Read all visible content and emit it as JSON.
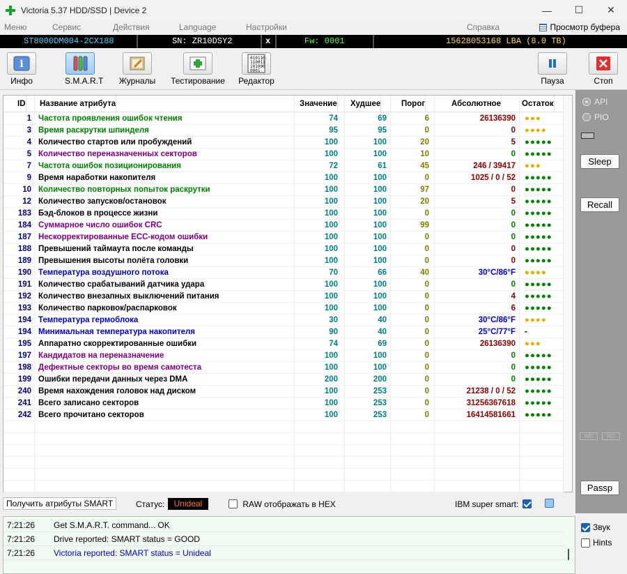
{
  "window": {
    "title": "Victoria 5.37 HDD/SSD | Device 2",
    "min": "—",
    "max": "☐",
    "close": "✕"
  },
  "menu": [
    "Меню",
    "Сервис",
    "Действия",
    "Language",
    "Настройки",
    "Справка"
  ],
  "buffer_label": "Просмотр буфера",
  "info": {
    "model": "ST8000DM004-2CX188",
    "sn": "SN: ZR10DSY2",
    "x": "x",
    "fw": "Fw: 0001",
    "lba": "15628053168 LBA (8.0 TB)"
  },
  "toolbar": {
    "info": "Инфо",
    "smart": "S.M.A.R.T",
    "logs": "Журналы",
    "test": "Тестирование",
    "editor": "Редактор",
    "pause": "Пауза",
    "stop": "Стоп"
  },
  "headers": {
    "id": "ID",
    "name": "Название атрибута",
    "value": "Значение",
    "worst": "Худшее",
    "thresh": "Порог",
    "raw": "Абсолютное",
    "health": "Остаток"
  },
  "colors": {
    "green": "#008000",
    "blue": "#0000cc",
    "purple": "#800080",
    "black": "#000000",
    "teal": "#008080",
    "olive": "#808000",
    "raw": "#8b0000",
    "dot_green": "#008000",
    "dot_yellow": "#e0b000"
  },
  "rows": [
    {
      "id": "1",
      "name": "Частота проявления ошибок чтения",
      "c": "green",
      "val": "74",
      "worst": "69",
      "thr": "6",
      "raw": "26136390",
      "rawc": "raw",
      "hl": "●●●",
      "hc": "dot_yellow"
    },
    {
      "id": "3",
      "name": "Время раскрутки шпинделя",
      "c": "green",
      "val": "95",
      "worst": "95",
      "thr": "0",
      "raw": "0",
      "rawc": "raw",
      "hl": "●●●●",
      "hc": "dot_yellow"
    },
    {
      "id": "4",
      "name": "Количество стартов или пробуждений",
      "c": "black",
      "val": "100",
      "worst": "100",
      "thr": "20",
      "raw": "5",
      "rawc": "raw",
      "hl": "●●●●●",
      "hc": "dot_green"
    },
    {
      "id": "5",
      "name": "Количество переназначенных секторов",
      "c": "purple",
      "val": "100",
      "worst": "100",
      "thr": "10",
      "raw": "0",
      "rawc": "green",
      "hl": "●●●●●",
      "hc": "dot_green"
    },
    {
      "id": "7",
      "name": "Частота ошибок позиционирования",
      "c": "green",
      "val": "72",
      "worst": "61",
      "thr": "45",
      "raw": "246 / 39417",
      "rawc": "raw",
      "hl": "●●●",
      "hc": "dot_yellow"
    },
    {
      "id": "9",
      "name": "Время наработки накопителя",
      "c": "black",
      "val": "100",
      "worst": "100",
      "thr": "0",
      "raw": "1025 / 0 / 52",
      "rawc": "raw",
      "hl": "●●●●●",
      "hc": "dot_green"
    },
    {
      "id": "10",
      "name": "Количество повторных попыток раскрутки",
      "c": "green",
      "val": "100",
      "worst": "100",
      "thr": "97",
      "raw": "0",
      "rawc": "raw",
      "hl": "●●●●●",
      "hc": "dot_green"
    },
    {
      "id": "12",
      "name": "Количество запусков/остановок",
      "c": "black",
      "val": "100",
      "worst": "100",
      "thr": "20",
      "raw": "5",
      "rawc": "raw",
      "hl": "●●●●●",
      "hc": "dot_green"
    },
    {
      "id": "183",
      "name": "Бэд-блоков в процессе жизни",
      "c": "black",
      "val": "100",
      "worst": "100",
      "thr": "0",
      "raw": "0",
      "rawc": "green",
      "hl": "●●●●●",
      "hc": "dot_green"
    },
    {
      "id": "184",
      "name": "Суммарное число ошибок CRC",
      "c": "purple",
      "val": "100",
      "worst": "100",
      "thr": "99",
      "raw": "0",
      "rawc": "green",
      "hl": "●●●●●",
      "hc": "dot_green"
    },
    {
      "id": "187",
      "name": "Нескорректированные ECC-кодом ошибки",
      "c": "purple",
      "val": "100",
      "worst": "100",
      "thr": "0",
      "raw": "0",
      "rawc": "green",
      "hl": "●●●●●",
      "hc": "dot_green"
    },
    {
      "id": "188",
      "name": "Превышений таймаута после команды",
      "c": "black",
      "val": "100",
      "worst": "100",
      "thr": "0",
      "raw": "0",
      "rawc": "raw",
      "hl": "●●●●●",
      "hc": "dot_green"
    },
    {
      "id": "189",
      "name": "Превышения высоты полёта головки",
      "c": "black",
      "val": "100",
      "worst": "100",
      "thr": "0",
      "raw": "0",
      "rawc": "raw",
      "hl": "●●●●●",
      "hc": "dot_green"
    },
    {
      "id": "190",
      "name": "Температура воздушного потока",
      "c": "blue",
      "val": "70",
      "worst": "66",
      "thr": "40",
      "raw": "30°C/86°F",
      "rawc": "blue",
      "hl": "●●●●",
      "hc": "dot_yellow"
    },
    {
      "id": "191",
      "name": "Количество срабатываний датчика удара",
      "c": "black",
      "val": "100",
      "worst": "100",
      "thr": "0",
      "raw": "0",
      "rawc": "green",
      "hl": "●●●●●",
      "hc": "dot_green"
    },
    {
      "id": "192",
      "name": "Количество внезапных выключений питания",
      "c": "black",
      "val": "100",
      "worst": "100",
      "thr": "0",
      "raw": "4",
      "rawc": "raw",
      "hl": "●●●●●",
      "hc": "dot_green"
    },
    {
      "id": "193",
      "name": "Количество парковок/распарковок",
      "c": "black",
      "val": "100",
      "worst": "100",
      "thr": "0",
      "raw": "6",
      "rawc": "raw",
      "hl": "●●●●●",
      "hc": "dot_green"
    },
    {
      "id": "194",
      "name": "Температура гермоблока",
      "c": "blue",
      "val": "30",
      "worst": "40",
      "thr": "0",
      "raw": "30°C/86°F",
      "rawc": "blue",
      "hl": "●●●●",
      "hc": "dot_yellow"
    },
    {
      "id": "194",
      "name": "Минимальная температура накопителя",
      "c": "blue",
      "val": "90",
      "worst": "40",
      "thr": "0",
      "raw": "25°C/77°F",
      "rawc": "blue",
      "hl": "-",
      "hc": "black"
    },
    {
      "id": "195",
      "name": "Аппаратно скорректированные ошибки",
      "c": "black",
      "val": "74",
      "worst": "69",
      "thr": "0",
      "raw": "26136390",
      "rawc": "raw",
      "hl": "●●●",
      "hc": "dot_yellow"
    },
    {
      "id": "197",
      "name": "Кандидатов на переназначение",
      "c": "purple",
      "val": "100",
      "worst": "100",
      "thr": "0",
      "raw": "0",
      "rawc": "green",
      "hl": "●●●●●",
      "hc": "dot_green"
    },
    {
      "id": "198",
      "name": "Дефектные секторы во время самотеста",
      "c": "purple",
      "val": "100",
      "worst": "100",
      "thr": "0",
      "raw": "0",
      "rawc": "green",
      "hl": "●●●●●",
      "hc": "dot_green"
    },
    {
      "id": "199",
      "name": "Ошибки передачи данных через DMA",
      "c": "black",
      "val": "200",
      "worst": "200",
      "thr": "0",
      "raw": "0",
      "rawc": "green",
      "hl": "●●●●●",
      "hc": "dot_green"
    },
    {
      "id": "240",
      "name": "Время нахождения головок над диском",
      "c": "black",
      "val": "100",
      "worst": "253",
      "thr": "0",
      "raw": "21238 / 0 / 52",
      "rawc": "raw",
      "hl": "●●●●●",
      "hc": "dot_green"
    },
    {
      "id": "241",
      "name": "Всего записано секторов",
      "c": "black",
      "val": "100",
      "worst": "253",
      "thr": "0",
      "raw": "31256367618",
      "rawc": "raw",
      "hl": "●●●●●",
      "hc": "dot_green"
    },
    {
      "id": "242",
      "name": "Всего прочитано секторов",
      "c": "black",
      "val": "100",
      "worst": "253",
      "thr": "0",
      "raw": "16414581661",
      "rawc": "raw",
      "hl": "●●●●●",
      "hc": "dot_green"
    }
  ],
  "status": {
    "get_btn": "Получить атрибуты SMART",
    "status_label": "Статус:",
    "status_value": "Unideal",
    "raw_hex": "RAW отображать в HEX",
    "ibm": "IBM super smart:"
  },
  "side": {
    "api": "API",
    "pio": "PIO",
    "sleep": "Sleep",
    "recall": "Recall",
    "wr": "WR",
    "rd": "RD",
    "passp": "Passp"
  },
  "log": [
    {
      "time": "7:21:26",
      "msg": "Get S.M.A.R.T. command... OK",
      "color": "#000000"
    },
    {
      "time": "7:21:26",
      "msg": "Drive reported: SMART status = GOOD",
      "color": "#000000"
    },
    {
      "time": "7:21:26",
      "msg": "Victoria reported: SMART status = Unideal",
      "color": "#0000cc"
    }
  ],
  "logside": {
    "sound": "Звук",
    "hints": "Hints"
  }
}
